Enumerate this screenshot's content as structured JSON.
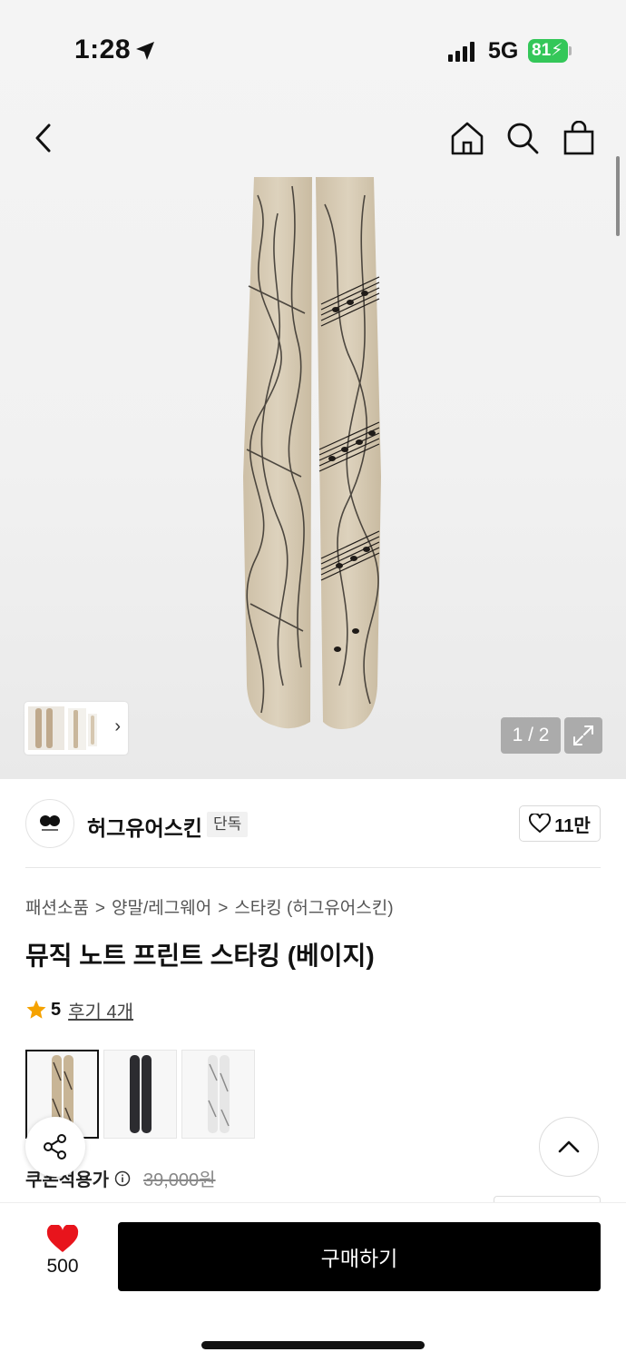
{
  "status_bar": {
    "time": "1:28",
    "network": "5G",
    "battery": "81",
    "battery_color": "#34c759"
  },
  "nav": {
    "back_icon": "chevron-left-icon",
    "home_icon": "home-icon",
    "search_icon": "search-icon",
    "bag_icon": "shopping-bag-icon"
  },
  "gallery": {
    "counter": "1 / 2",
    "expand_icon": "expand-icon"
  },
  "brand": {
    "name": "허그유어스킨",
    "badge": "단독",
    "likes": "11만"
  },
  "breadcrumb": [
    "패션소품",
    "양말/레그웨어",
    "스타킹 (허그유어스킨)"
  ],
  "product": {
    "title": "뮤직 노트 프린트 스타킹 (베이지)",
    "rating": "5",
    "review_link": "후기 4개",
    "variants": [
      "beige",
      "black",
      "white"
    ]
  },
  "price": {
    "label": "쿠폰적용가",
    "original": "39,000원"
  },
  "bottom_bar": {
    "wish_count": "500",
    "buy_label": "구매하기",
    "heart_color": "#e8141c"
  }
}
